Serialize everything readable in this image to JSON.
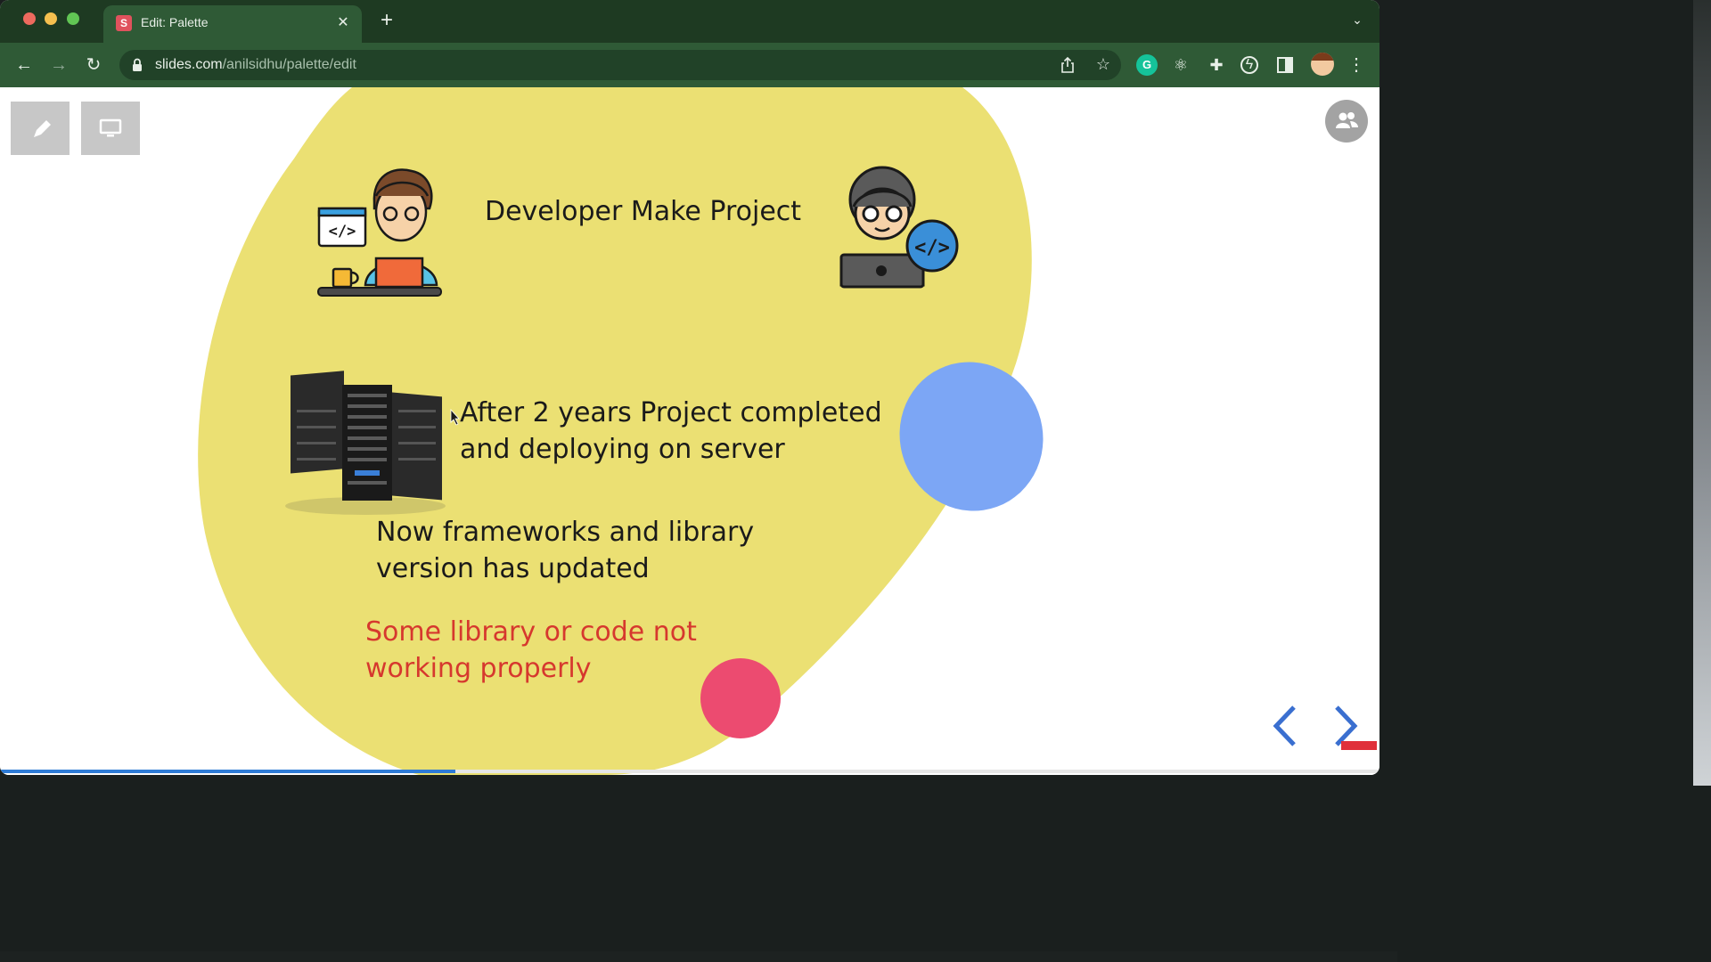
{
  "browser": {
    "tab_title": "Edit: Palette",
    "tab_favicon_letter": "S",
    "url_domain": "slides.com",
    "url_path": "/anilsidhu/palette/edit",
    "extension_grammarly_letter": "G",
    "accent_color": "#2f5a36"
  },
  "slide": {
    "heading": "Developer Make Project",
    "deploy_line1": "After 2 years Project completed",
    "deploy_line2": "and deploying on server",
    "updated_line1": "Now frameworks and  library",
    "updated_line2": "version has updated",
    "warning_line1": "Some library or code not",
    "warning_line2": "working properly",
    "warning_color": "#d6382e",
    "blob_color": "#ebe073",
    "blue_blob_color": "#7ca6f5",
    "pink_circle_color": "#ec4b70",
    "progress_fraction": 0.33
  }
}
